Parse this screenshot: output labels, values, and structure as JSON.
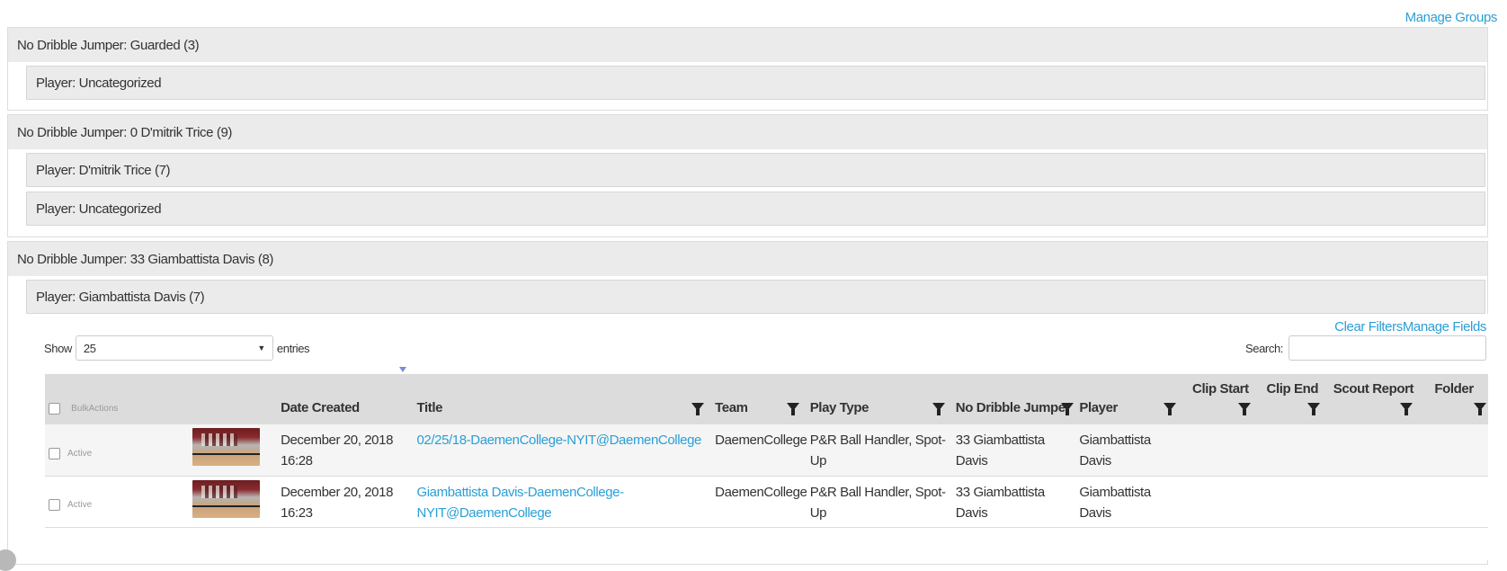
{
  "manage_groups": "Manage Groups",
  "groups": [
    {
      "title": "No Dribble Jumper: Guarded (3)",
      "subs": [
        "Player: Uncategorized"
      ]
    },
    {
      "title": "No Dribble Jumper: 0 D'mitrik Trice (9)",
      "subs": [
        "Player: D'mitrik Trice (7)",
        "Player: Uncategorized"
      ]
    },
    {
      "title": "No Dribble Jumper: 33 Giambattista Davis (8)",
      "subs": [
        "Player: Giambattista Davis (7)"
      ]
    }
  ],
  "table_controls": {
    "clear_filters": "Clear Filters",
    "manage_fields": "Manage Fields",
    "show": "Show",
    "entries_value": "25",
    "entries": "entries",
    "search": "Search:"
  },
  "columns": {
    "bulk": "BulkActions",
    "date": "Date Created",
    "title": "Title",
    "team": "Team",
    "play_type": "Play Type",
    "ndj": "No Dribble Jumper",
    "player": "Player",
    "clip_start": "Clip Start",
    "clip_end": "Clip End",
    "scout_report": "Scout Report",
    "folder": "Folder"
  },
  "rows": [
    {
      "status": "Active",
      "date": "December 20, 2018 16:28",
      "title": "02/25/18-DaemenCollege-NYIT@DaemenCollege",
      "team": "DaemenCollege",
      "play_type": "P&R Ball Handler, Spot-Up",
      "ndj": "33 Giambattista Davis",
      "player": "Giambattista Davis"
    },
    {
      "status": "Active",
      "date": "December 20, 2018 16:23",
      "title": "Giambattista Davis-DaemenCollege-NYIT@DaemenCollege",
      "team": "DaemenCollege",
      "play_type": "P&R Ball Handler, Spot-Up",
      "ndj": "33 Giambattista Davis",
      "player": "Giambattista Davis"
    }
  ]
}
